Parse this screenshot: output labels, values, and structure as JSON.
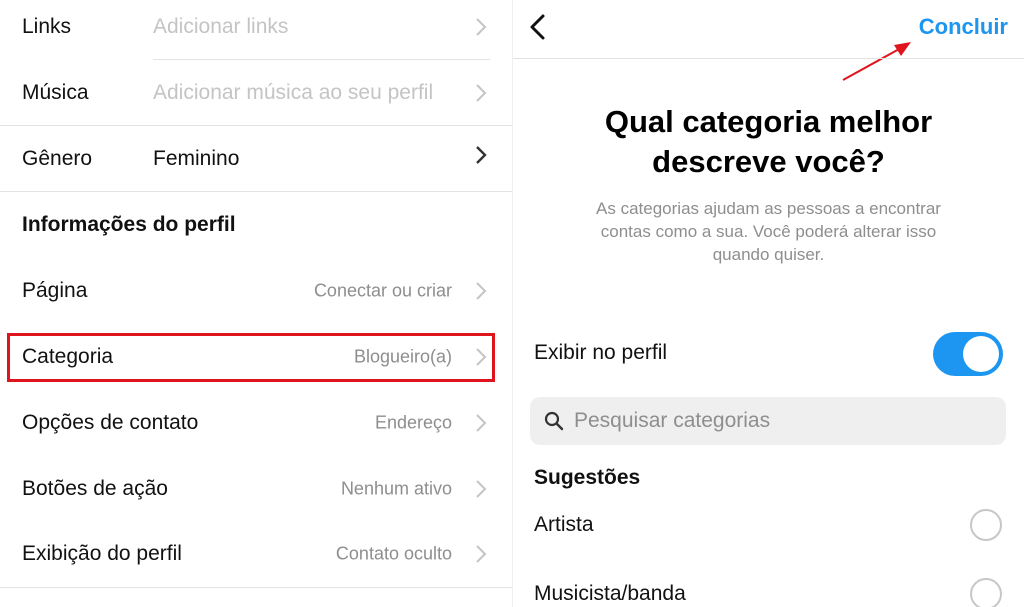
{
  "left": {
    "rows": [
      {
        "label": "Links",
        "value": "Adicionar links"
      },
      {
        "label": "Música",
        "value": "Adicionar música ao seu perfil"
      },
      {
        "label": "Gênero",
        "value": "Feminino"
      }
    ],
    "section_title": "Informações do perfil",
    "profile_rows": [
      {
        "label": "Página",
        "value": "Conectar ou criar"
      },
      {
        "label": "Categoria",
        "value": "Blogueiro(a)"
      },
      {
        "label": "Opções de contato",
        "value": "Endereço"
      },
      {
        "label": "Botões de ação",
        "value": "Nenhum ativo"
      },
      {
        "label": "Exibição do perfil",
        "value": "Contato oculto"
      }
    ]
  },
  "right": {
    "done_label": "Concluir",
    "heading_line1": "Qual categoria melhor",
    "heading_line2": "descreve você?",
    "sub_line1": "As categorias ajudam as pessoas a encontrar",
    "sub_line2": "contas como a sua. Você poderá alterar isso",
    "sub_line3": "quando quiser.",
    "toggle_label": "Exibir no perfil",
    "toggle_on": true,
    "search_placeholder": "Pesquisar categorias",
    "suggestions_title": "Sugestões",
    "options": [
      "Artista",
      "Musicista/banda"
    ]
  },
  "colors": {
    "accent": "#1c96f0",
    "highlight": "#e0141c",
    "arrow": "#e0141c",
    "muted": "#8e8e8e",
    "placeholder": "#c4c4c4"
  },
  "icons": {
    "back": "chevron-left-icon",
    "row_chevron": "chevron-right-icon",
    "search": "search-icon"
  }
}
